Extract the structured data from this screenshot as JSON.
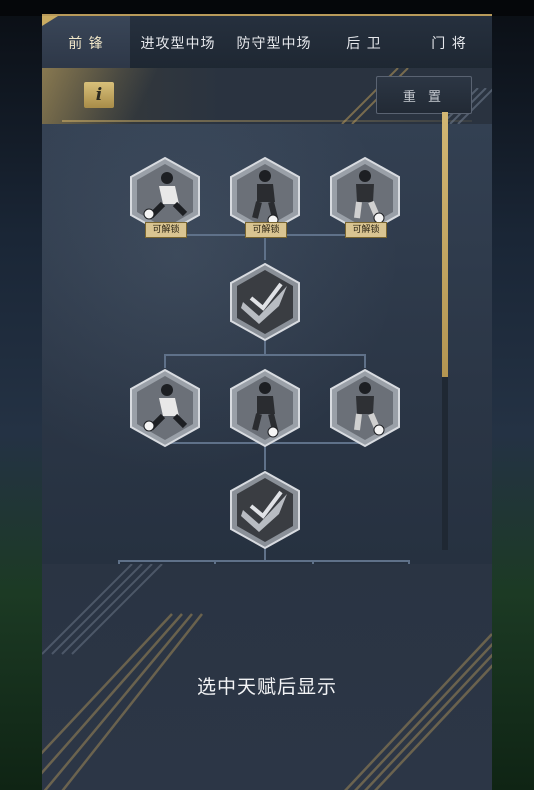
{
  "tabs": [
    {
      "label": "前 锋",
      "active": true
    },
    {
      "label": "进攻型中场",
      "active": false
    },
    {
      "label": "防守型中场",
      "active": false
    },
    {
      "label": "后 卫",
      "active": false
    },
    {
      "label": "门 将",
      "active": false
    }
  ],
  "toolbar": {
    "info_label": "i",
    "reset_label": "重 置"
  },
  "talent_tree": {
    "row1": [
      {
        "icon": "player-sprint-icon",
        "badge": "可解锁"
      },
      {
        "icon": "player-dribble-icon",
        "badge": "可解锁"
      },
      {
        "icon": "player-kick-icon",
        "badge": "可解锁"
      }
    ],
    "connector1": {
      "icon": "rank-chevron-icon"
    },
    "row2": [
      {
        "icon": "player-sprint-icon"
      },
      {
        "icon": "player-dribble-icon"
      },
      {
        "icon": "player-kick-icon"
      }
    ],
    "connector2": {
      "icon": "rank-chevron-icon"
    }
  },
  "details": {
    "hint": "选中天赋后显示"
  },
  "colors": {
    "accent_gold": "#c9ab62",
    "panel": "#2b3544",
    "connector_line": "#5f7189"
  }
}
